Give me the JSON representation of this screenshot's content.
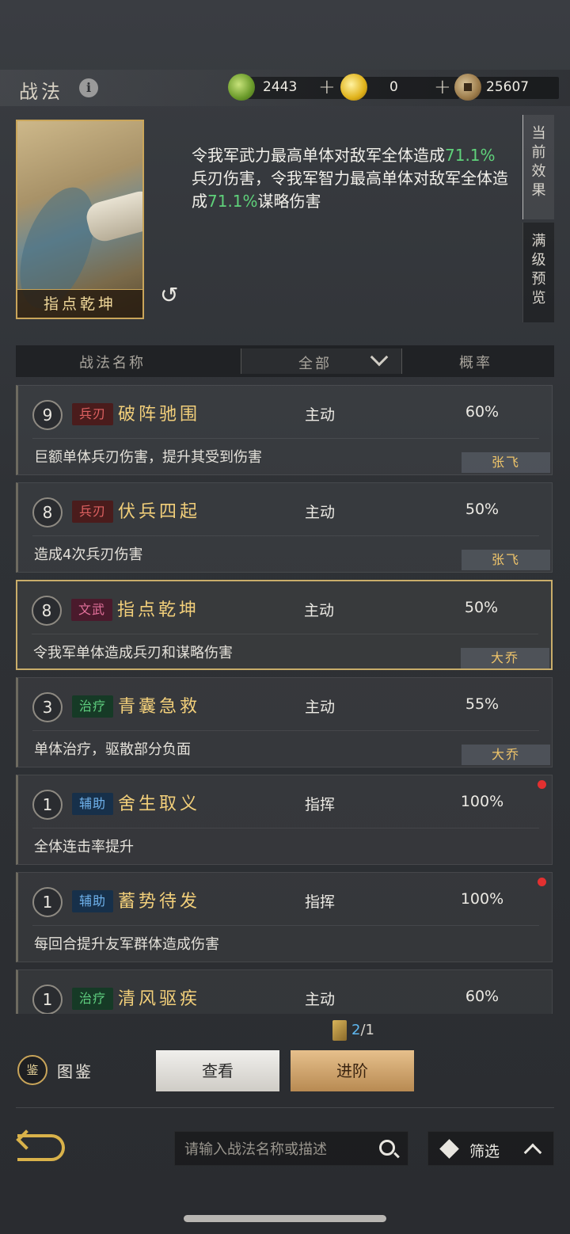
{
  "header": {
    "title": "战法",
    "resources": [
      {
        "icon": "jade-coin-icon",
        "value": "2443"
      },
      {
        "icon": "gold-coin-icon",
        "value": "0"
      },
      {
        "icon": "copper-coin-icon",
        "value": "25607"
      }
    ],
    "plus": "+"
  },
  "detail": {
    "card_name": "指点乾坤",
    "effect": {
      "p1": "令我军武力最高单体对敌军全体造成",
      "v1": "71.1%",
      "p2": "兵刃伤害，令我军智力最高单体对敌军全体造成",
      "v2": "71.1%",
      "p3": "谋略伤害"
    },
    "tabs": [
      {
        "chars": [
          "当",
          "前",
          "效",
          "果"
        ]
      },
      {
        "chars": [
          "满",
          "级",
          "预",
          "览"
        ]
      }
    ]
  },
  "table_header": {
    "name_col": "战法名称",
    "filter_value": "全部",
    "rate_col": "概率"
  },
  "skills": [
    {
      "level": "9",
      "tag": "兵刃",
      "tag_class": "bing",
      "name": "破阵驰围",
      "type": "主动",
      "rate": "60%",
      "desc": "巨额单体兵刃伤害，提升其受到伤害",
      "owner": "张飞"
    },
    {
      "level": "8",
      "tag": "兵刃",
      "tag_class": "bing",
      "name": "伏兵四起",
      "type": "主动",
      "rate": "50%",
      "desc": "造成4次兵刃伤害",
      "owner": "张飞"
    },
    {
      "level": "8",
      "tag": "文武",
      "tag_class": "wen",
      "name": "指点乾坤",
      "type": "主动",
      "rate": "50%",
      "desc": "令我军单体造成兵刃和谋略伤害",
      "owner": "大乔"
    },
    {
      "level": "3",
      "tag": "治疗",
      "tag_class": "zhi",
      "name": "青囊急救",
      "type": "主动",
      "rate": "55%",
      "desc": "单体治疗，驱散部分负面",
      "owner": "大乔"
    },
    {
      "level": "1",
      "tag": "辅助",
      "tag_class": "fu",
      "name": "舍生取义",
      "type": "指挥",
      "rate": "100%",
      "desc": "全体连击率提升",
      "owner": ""
    },
    {
      "level": "1",
      "tag": "辅助",
      "tag_class": "fu",
      "name": "蓄势待发",
      "type": "指挥",
      "rate": "100%",
      "desc": "每回合提升友军群体造成伤害",
      "owner": ""
    },
    {
      "level": "1",
      "tag": "治疗",
      "tag_class": "zhi",
      "name": "清风驱疾",
      "type": "主动",
      "rate": "60%",
      "desc": "",
      "owner": ""
    }
  ],
  "footer": {
    "counter_current": "2",
    "counter_total": "/1",
    "tujian_icon_text": "鉴",
    "tujian_label": "图鉴",
    "view_button": "查看",
    "advance_button": "进阶",
    "search_placeholder": "请输入战法名称或描述",
    "filter_label": "筛选"
  }
}
